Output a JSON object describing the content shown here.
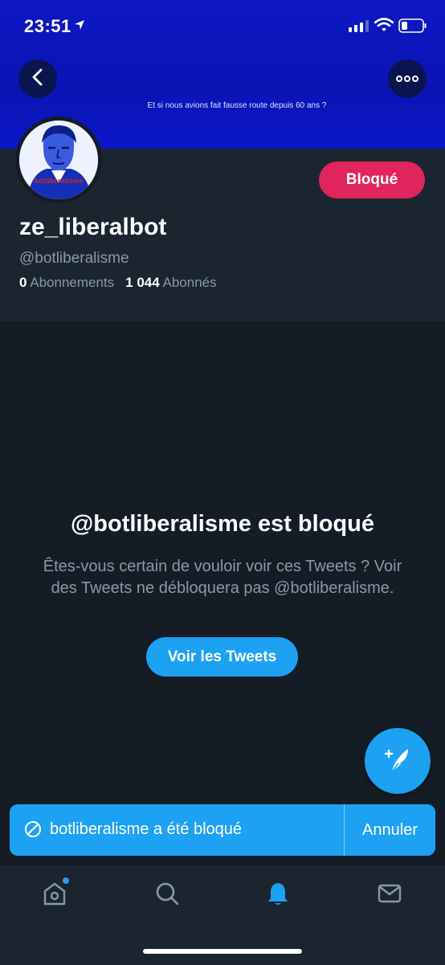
{
  "status_bar": {
    "time": "23:51"
  },
  "header": {
    "banner_caption": "Et si nous avions fait fausse route depuis 60 ans ?"
  },
  "profile": {
    "avatar_label": "botliberalisme",
    "display_name": "ze_liberalbot",
    "handle": "@botliberalisme",
    "following_count": "0",
    "following_label": "Abonnements",
    "followers_count": "1 044",
    "followers_label": "Abonnés",
    "blocked_button_label": "Bloqué"
  },
  "blocked_notice": {
    "title": "@botliberalisme est bloqué",
    "description": "Êtes-vous certain de vouloir voir ces Tweets ? Voir des Tweets ne débloquera pas @botliberalisme.",
    "view_button_label": "Voir les Tweets"
  },
  "toast": {
    "message": "botliberalisme a été bloqué",
    "undo_label": "Annuler"
  },
  "tabbar": {
    "items": [
      {
        "name": "home",
        "icon": "home-icon",
        "badge": true
      },
      {
        "name": "search",
        "icon": "search-icon"
      },
      {
        "name": "notifications",
        "icon": "bell-icon",
        "active": true
      },
      {
        "name": "messages",
        "icon": "envelope-icon"
      }
    ]
  },
  "colors": {
    "background": "#141d26",
    "panel": "#1b2530",
    "accent": "#1da1f2",
    "blocked": "#e0245e",
    "banner": "#0d18c4",
    "muted_text": "#8899a6"
  }
}
